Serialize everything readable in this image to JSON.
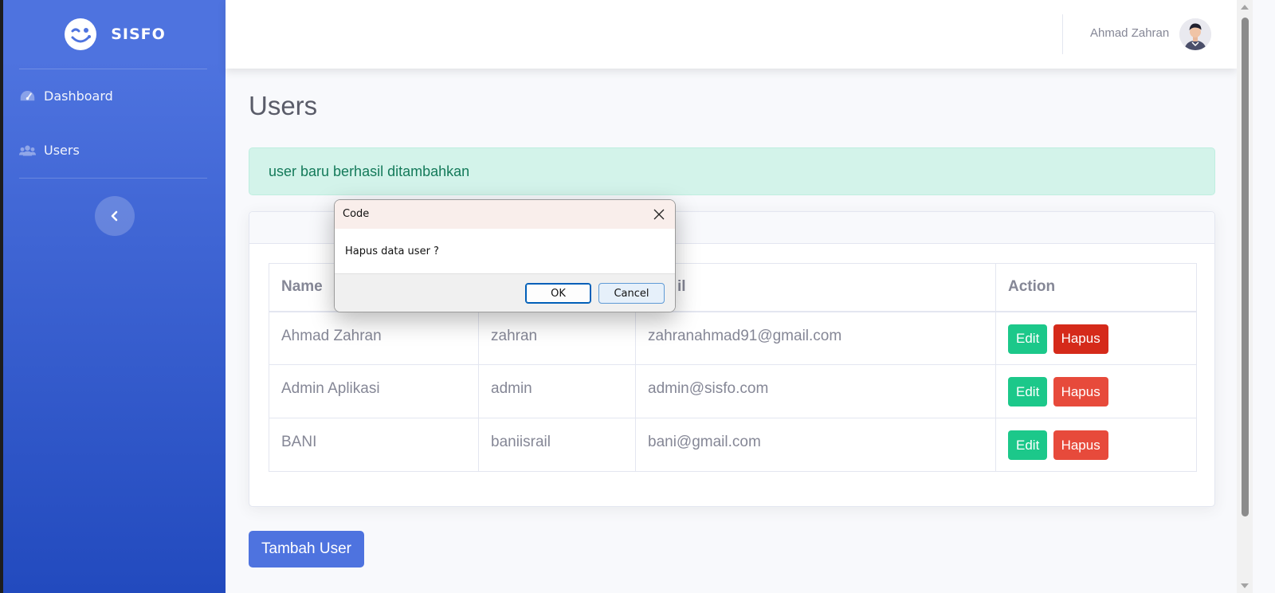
{
  "brand": {
    "name": "SISFO",
    "icon": "wink-face-icon"
  },
  "sidebar": {
    "items": [
      {
        "label": "Dashboard",
        "icon": "tachometer-icon"
      },
      {
        "label": "Users",
        "icon": "users-icon"
      }
    ],
    "toggle_icon": "chevron-left-icon"
  },
  "topbar": {
    "user_name": "Ahmad Zahran",
    "avatar": "user-avatar"
  },
  "page": {
    "title": "Users"
  },
  "alert": {
    "message": "user baru berhasil ditambahkan",
    "color": "#d3f3ea"
  },
  "table": {
    "headers": [
      "Name",
      "",
      "il",
      "Action"
    ],
    "rows": [
      {
        "name": "Ahmad Zahran",
        "username": "zahran",
        "email": "zahranahmad91@gmail.com"
      },
      {
        "name": "Admin Aplikasi",
        "username": "admin",
        "email": "admin@sisfo.com"
      },
      {
        "name": "BANI",
        "username": "baniisrail",
        "email": "bani@gmail.com"
      }
    ],
    "edit_label": "Edit",
    "delete_label": "Hapus"
  },
  "add_button": {
    "label": "Tambah User"
  },
  "dialog": {
    "title": "Code",
    "message": "Hapus data user ?",
    "ok_label": "OK",
    "cancel_label": "Cancel"
  },
  "colors": {
    "primary": "#4e73df",
    "success": "#1cc88a",
    "danger": "#e74a3b"
  }
}
